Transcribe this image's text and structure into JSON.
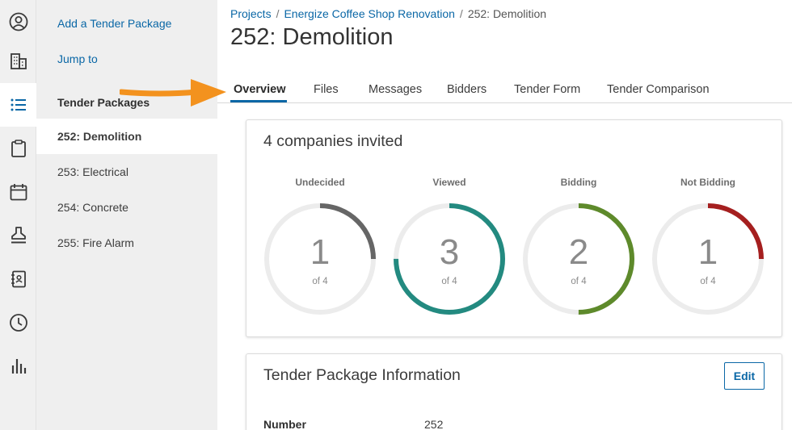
{
  "rail": {
    "items": [
      {
        "icon": "user-circle-icon"
      },
      {
        "icon": "building-icon"
      },
      {
        "icon": "list-icon",
        "active": true
      },
      {
        "icon": "clipboard-icon"
      },
      {
        "icon": "calendar-icon"
      },
      {
        "icon": "stamp-icon"
      },
      {
        "icon": "address-book-icon"
      },
      {
        "icon": "clock-icon"
      },
      {
        "icon": "bar-chart-icon"
      }
    ]
  },
  "subnav": {
    "add_tender_package": "Add a Tender Package",
    "jump_to": "Jump to",
    "section_title": "Tender Packages",
    "packages": [
      {
        "label": "252: Demolition",
        "active": true
      },
      {
        "label": "253: Electrical"
      },
      {
        "label": "254: Concrete"
      },
      {
        "label": "255: Fire Alarm"
      }
    ]
  },
  "breadcrumb": {
    "projects": "Projects",
    "project": "Energize Coffee Shop Renovation",
    "current": "252: Demolition"
  },
  "page_title": "252: Demolition",
  "tabs": [
    {
      "label": "Overview",
      "active": true
    },
    {
      "label": "Files"
    },
    {
      "label": "Messages"
    },
    {
      "label": "Bidders"
    },
    {
      "label": "Tender Form"
    },
    {
      "label": "Tender Comparison"
    }
  ],
  "invited": {
    "title": "4 companies invited",
    "total_text": "of 4",
    "total": 4,
    "stats": [
      {
        "label": "Undecided",
        "value": "1",
        "count": 1,
        "color": "#666666"
      },
      {
        "label": "Viewed",
        "value": "3",
        "count": 3,
        "color": "#238a80"
      },
      {
        "label": "Bidding",
        "value": "2",
        "count": 2,
        "color": "#5e8a2b"
      },
      {
        "label": "Not Bidding",
        "value": "1",
        "count": 1,
        "color": "#a51f1f"
      }
    ]
  },
  "info": {
    "title": "Tender Package Information",
    "edit_label": "Edit",
    "number_label": "Number",
    "number_value": "252"
  },
  "colors": {
    "accent": "#0a67a6",
    "annotation_arrow": "#f3921e",
    "track": "#ececec"
  }
}
